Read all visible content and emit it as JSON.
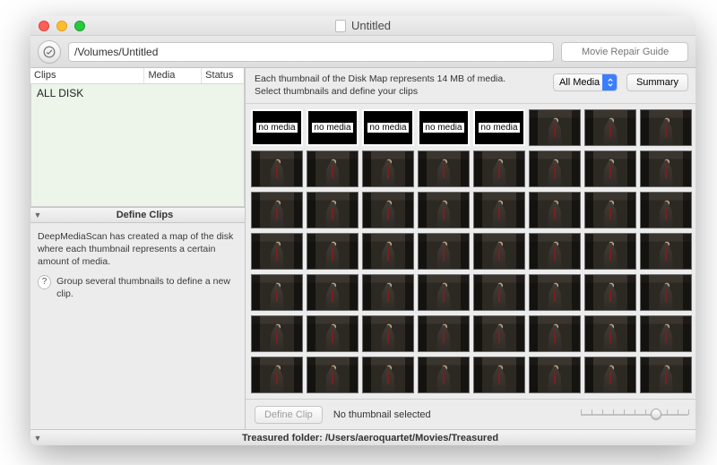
{
  "window": {
    "title": "Untitled"
  },
  "toolbar": {
    "path_value": "/Volumes/Untitled",
    "search_placeholder": "Movie Repair Guide"
  },
  "columns": {
    "clips": "Clips",
    "media": "Media",
    "status": "Status"
  },
  "instructions": {
    "line1": "Each thumbnail of the Disk Map represents 14 MB of media.",
    "line2": "Select thumbnails and define your clips"
  },
  "filter": {
    "selected": "All Media"
  },
  "summary_button": "Summary",
  "clips_list": {
    "all_disk": "ALL DISK"
  },
  "define_panel": {
    "title": "Define Clips",
    "body": "DeepMediaScan has created a map of the disk where each thumbnail represents a certain amount of media.",
    "hint": "Group several thumbnails to define a new clip."
  },
  "thumb_footer": {
    "define_button": "Define Clip",
    "status": "No thumbnail selected"
  },
  "statusbar": {
    "text": "Treasured folder: /Users/aeroquartet/Movies/Treasured"
  },
  "no_media_label": "no media",
  "grid": {
    "cols": 8,
    "rows": 7,
    "no_media_count": 5
  },
  "slider": {
    "ticks": 11,
    "position_pct": 70
  }
}
